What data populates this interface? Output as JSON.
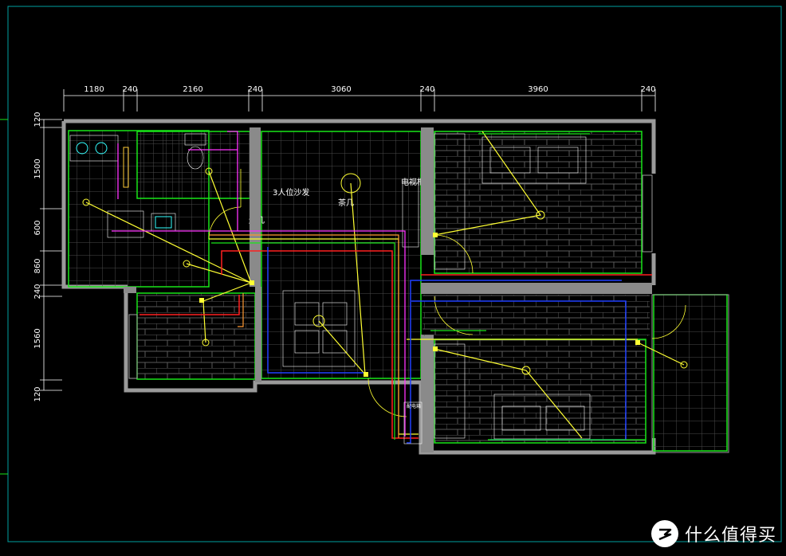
{
  "dimensions": {
    "top": [
      "1180",
      "240",
      "2160",
      "240",
      "3060",
      "240",
      "3960",
      "240"
    ],
    "left": [
      "120",
      "1500",
      "600",
      "860",
      "240",
      "1560",
      "120"
    ]
  },
  "labels": {
    "sofa": "3人位沙发",
    "coffee_table": "茶几",
    "tv_cabinet": "电视柜",
    "side_table": "边几",
    "panel_label": "配电箱",
    "watermark": "什么值得买"
  },
  "colors": {
    "background": "#000000",
    "wall": "#9a9a9a",
    "room_outline": "#19e619",
    "tile_grid": "#4a4a4a",
    "brick": "#5a5a5a",
    "frame": "#00a0a0",
    "light_circuit": "#ffff33",
    "power_circuit_red": "#ff2020",
    "power_circuit_blue": "#2040ff",
    "circuit_magenta": "#ff33ff",
    "circuit_orange": "#ff9933",
    "fixture_cyan": "#33ffff"
  },
  "icons": {
    "watermark_logo": "zhide-logo-icon",
    "light_fixture": "light-fixture-icon"
  }
}
